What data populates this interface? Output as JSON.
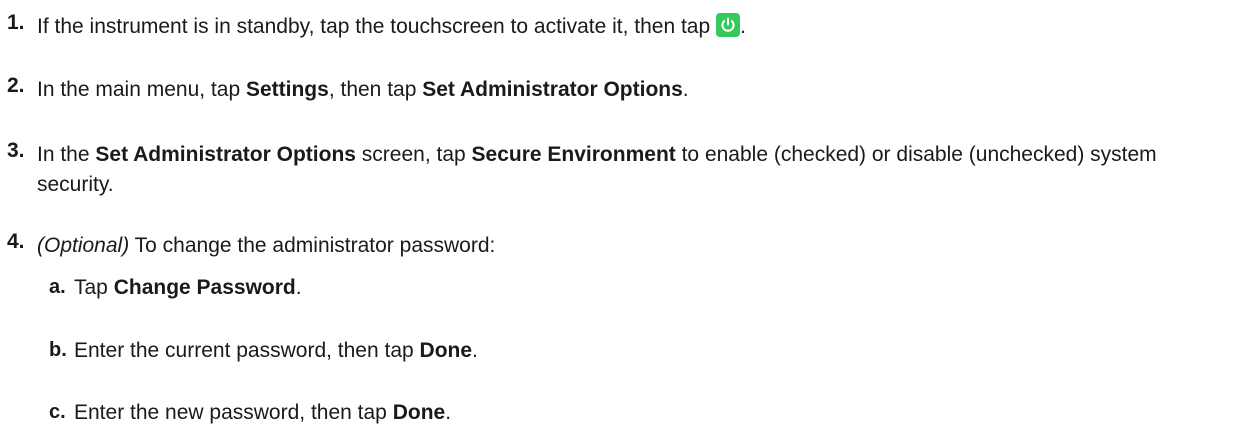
{
  "steps": [
    {
      "num": "1.",
      "parts": [
        "If the instrument is in standby, tap the touchscreen to activate it, then tap",
        "."
      ],
      "icon": "power-icon",
      "icon_color": "#35c85a"
    },
    {
      "num": "2.",
      "parts": [
        "In the main menu, tap ",
        "Settings",
        ", then tap ",
        "Set Administrator Options",
        "."
      ]
    },
    {
      "num": "3.",
      "parts": [
        "In the ",
        "Set Administrator Options",
        " screen, tap ",
        "Secure Environment",
        " to enable (checked) or disable (unchecked) system security."
      ]
    },
    {
      "num": "4.",
      "parts": [
        "(Optional)",
        " To change the administrator password:"
      ]
    }
  ],
  "substeps": [
    {
      "num": "a.",
      "parts": [
        "Tap ",
        "Change Password",
        "."
      ]
    },
    {
      "num": "b.",
      "parts": [
        "Enter the current password, then tap ",
        "Done",
        "."
      ]
    },
    {
      "num": "c.",
      "parts": [
        "Enter the new password, then tap ",
        "Done",
        "."
      ]
    }
  ]
}
